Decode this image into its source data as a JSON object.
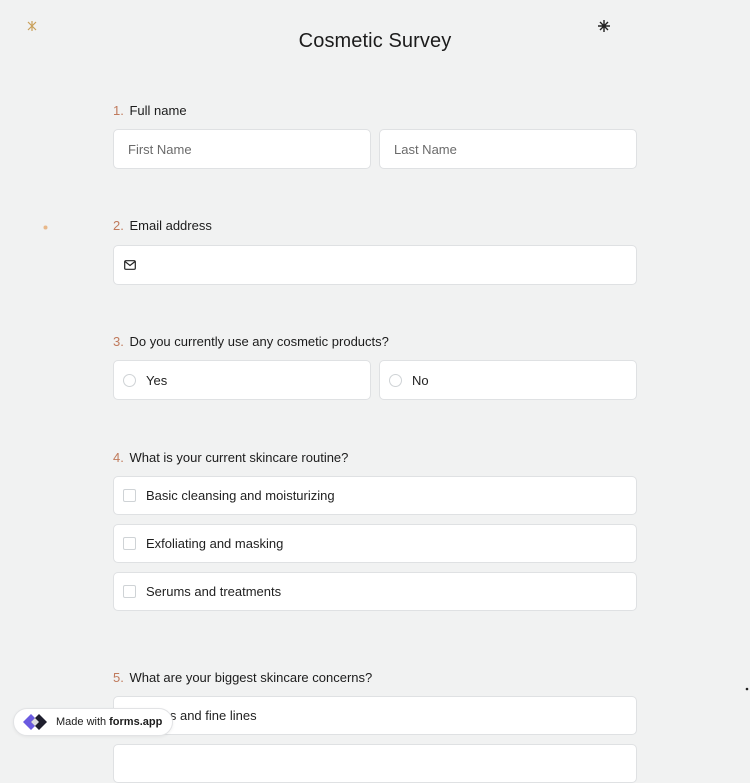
{
  "form": {
    "title": "Cosmetic Survey"
  },
  "questions": {
    "q1": {
      "number": "1.",
      "label": "Full name",
      "first_placeholder": "First Name",
      "last_placeholder": "Last Name"
    },
    "q2": {
      "number": "2.",
      "label": "Email address",
      "icon": "envelope-icon",
      "value": ""
    },
    "q3": {
      "number": "3.",
      "label": "Do you currently use any cosmetic products?",
      "options": [
        "Yes",
        "No"
      ]
    },
    "q4": {
      "number": "4.",
      "label": "What is your current skincare routine?",
      "options": [
        "Basic cleansing and moisturizing",
        "Exfoliating and masking",
        "Serums and treatments"
      ]
    },
    "q5": {
      "number": "5.",
      "label": "What are your biggest skincare concerns?",
      "options": [
        "nkles and fine lines"
      ]
    }
  },
  "badge": {
    "prefix": "Made with",
    "brand": "forms.app",
    "icon": "forms-app-logo"
  },
  "colors": {
    "background": "#f1f2f2",
    "question_number": "#c07a5c",
    "border": "#dfe1e3",
    "logo_primary": "#6a5ae0"
  }
}
